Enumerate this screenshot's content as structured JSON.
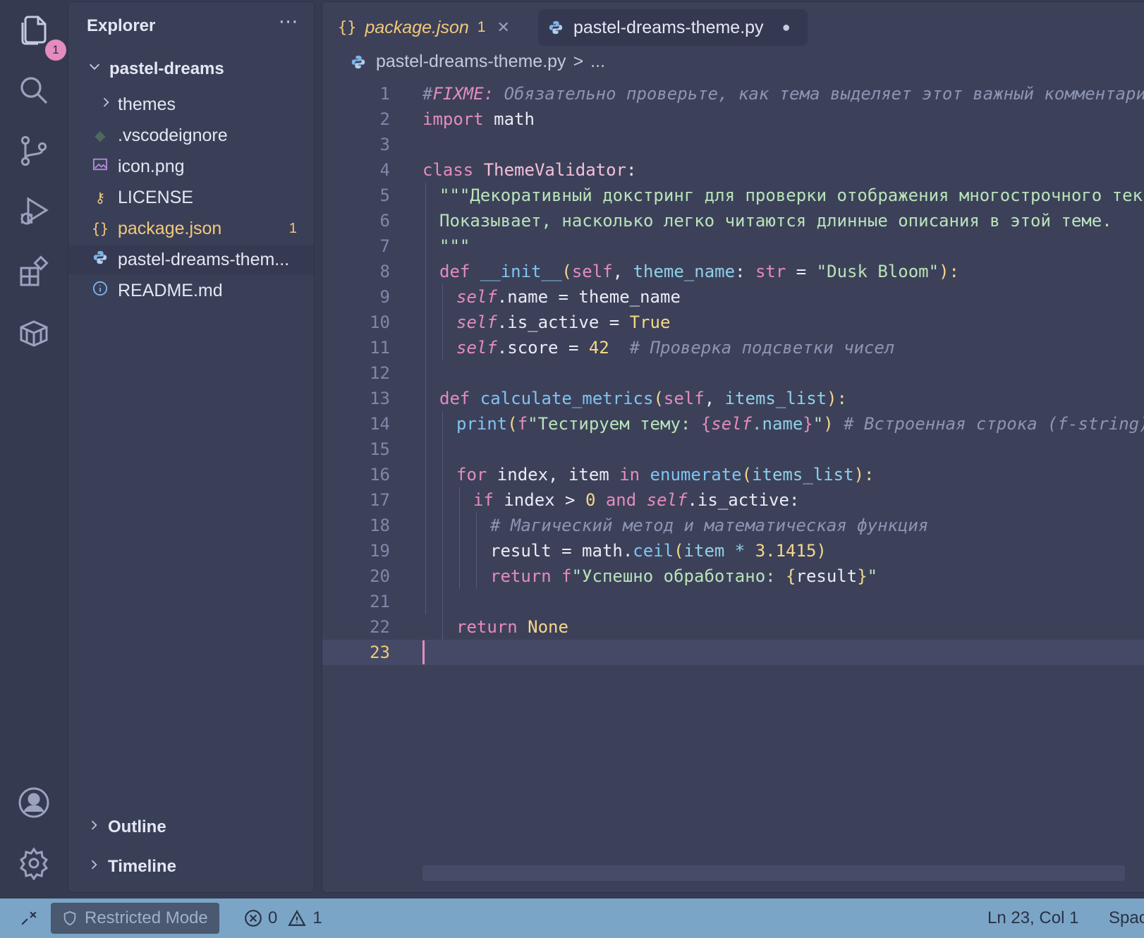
{
  "activity": {
    "explorer_badge": "1",
    "icons": [
      "files-icon",
      "search-icon",
      "source-control-icon",
      "run-debug-icon",
      "extensions-icon",
      "remote-explorer-icon",
      "account-icon",
      "settings-gear-icon"
    ]
  },
  "sidebar": {
    "title": "Explorer",
    "more": "···",
    "root": "pastel-dreams",
    "items": [
      {
        "label": "themes",
        "icon": "chevron-right-icon"
      },
      {
        "label": ".vscodeignore",
        "icon": "git-icon"
      },
      {
        "label": "icon.png",
        "icon": "image-icon"
      },
      {
        "label": "LICENSE",
        "icon": "license-key-icon"
      },
      {
        "label": "package.json",
        "icon": "json-braces-icon",
        "count": "1"
      },
      {
        "label": "pastel-dreams-them...",
        "icon": "python-icon"
      },
      {
        "label": "README.md",
        "icon": "info-icon"
      }
    ],
    "outline": "Outline",
    "timeline": "Timeline"
  },
  "tabs": [
    {
      "icon": "{}",
      "label": "package.json",
      "count": "1",
      "close": "✕"
    },
    {
      "label": "pastel-dreams-theme.py",
      "dot": "●"
    }
  ],
  "breadcrumb": {
    "file": "pastel-dreams-theme.py",
    "sep": ">",
    "more": "..."
  },
  "code": {
    "line_numbers": [
      "1",
      "2",
      "3",
      "4",
      "5",
      "6",
      "7",
      "8",
      "9",
      "10",
      "11",
      "12",
      "13",
      "14",
      "15",
      "16",
      "17",
      "18",
      "19",
      "20",
      "21",
      "22",
      "23"
    ],
    "l1": {
      "hash": "#",
      "fixme": "FIXME:",
      "text": " Обязательно проверьте, как тема выделяет этот важный комментарий!"
    },
    "l2": {
      "kw": "import",
      "mod": " math"
    },
    "l4": {
      "kw": "class",
      "name": " ThemeValidator",
      "colon": ":"
    },
    "l5": {
      "text": "\"\"\"Декоративный докстринг для проверки отображения многострочного текста."
    },
    "l6": {
      "text": "Показывает, насколько легко читаются длинные описания в этой теме."
    },
    "l7": {
      "text": "\"\"\""
    },
    "l8": {
      "kw": "def",
      "fn": " __init__",
      "p1": "(",
      "self": "self",
      ",": ", ",
      "param": "theme_name",
      "colon": ":",
      "type": " str",
      "eq": " = ",
      "str": "\"Dusk Bloom\"",
      "p2": "):"
    },
    "l9": {
      "self": "self",
      "attr": ".name",
      "eq": " = ",
      "val": "theme_name"
    },
    "l10": {
      "self": "self",
      "attr": ".is_active",
      "eq": " = ",
      "val": "True"
    },
    "l11": {
      "self": "self",
      "attr": ".score",
      "eq": " = ",
      "num": "42",
      "comment": "  # Проверка подсветки чисел"
    },
    "l13": {
      "kw": "def",
      "fn": " calculate_metrics",
      "p1": "(",
      "self": "self",
      ",": ", ",
      "param": "items_list",
      "p2": "):"
    },
    "l14": {
      "fn": "print",
      "p1": "(",
      "f": "f",
      "str1": "\"Тестируем тему: ",
      "b1": "{",
      "self": "self",
      "attr": ".name",
      "b2": "}",
      "str2": "\"",
      "p2": ")",
      "comment": " # Встроенная строка (f-string)"
    },
    "l16": {
      "kw": "for",
      "a": " index, item ",
      "in": "in",
      "fn": " enumerate",
      "p1": "(",
      "arg": "items_list",
      "p2": "):"
    },
    "l17": {
      "kw": "if",
      "a": " index > ",
      "num": "0",
      "and": " and ",
      "self": "self",
      "attr": ".is_active",
      "colon": ":"
    },
    "l18": {
      "comment": "# Магический метод и математическая функция"
    },
    "l19": {
      "v": "result = math.",
      "fn": "ceil",
      "p1": "(",
      "a": "item * ",
      "num": "3.1415",
      "p2": ")"
    },
    "l20": {
      "kw": "return",
      "f": " f",
      "str1": "\"Успешно обработано: ",
      "b1": "{",
      "v": "result",
      "b2": "}",
      "str2": "\""
    },
    "l22": {
      "kw": "return",
      "val": " None"
    }
  },
  "status": {
    "remote_icon": "remote-icon",
    "restricted": "Restricted Mode",
    "errors": "0",
    "warnings": "1",
    "position": "Ln 23, Col 1",
    "spaces": "Spac"
  }
}
